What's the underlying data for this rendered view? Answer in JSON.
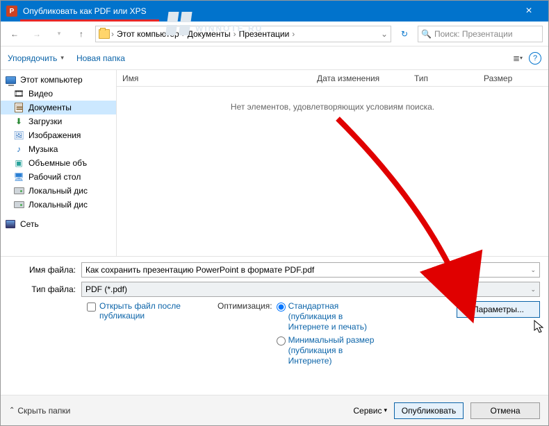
{
  "titlebar": {
    "title": "Опубликовать как PDF или XPS"
  },
  "watermark": "WINNOTE.RU",
  "nav": {
    "segments": [
      "Этот компьютер",
      "Документы",
      "Презентации"
    ],
    "search_placeholder": "Поиск: Презентации"
  },
  "toolbar": {
    "organize": "Упорядочить",
    "new_folder": "Новая папка"
  },
  "sidebar": {
    "items": [
      {
        "label": "Этот компьютер",
        "icon": "pc"
      },
      {
        "label": "Видео",
        "icon": "video"
      },
      {
        "label": "Документы",
        "icon": "doc",
        "selected": true
      },
      {
        "label": "Загрузки",
        "icon": "down"
      },
      {
        "label": "Изображения",
        "icon": "img"
      },
      {
        "label": "Музыка",
        "icon": "music"
      },
      {
        "label": "Объемные объ",
        "icon": "cube"
      },
      {
        "label": "Рабочий стол",
        "icon": "desk"
      },
      {
        "label": "Локальный дис",
        "icon": "drive"
      },
      {
        "label": "Локальный дис",
        "icon": "drive"
      }
    ],
    "network": "Сеть"
  },
  "columns": {
    "name": "Имя",
    "date": "Дата изменения",
    "type": "Тип",
    "size": "Размер"
  },
  "empty": "Нет элементов, удовлетворяющих условиям поиска.",
  "form": {
    "filename_label": "Имя файла:",
    "filename": "Как сохранить презентацию PowerPoint в формате PDF.pdf",
    "filetype_label": "Тип файла:",
    "filetype": "PDF (*.pdf)",
    "open_after": "Открыть файл после публикации",
    "optimization_label": "Оптимизация:",
    "opt_standard": "Стандартная (публикация в Интернете и печать)",
    "opt_minimum": "Минимальный размер (публикация в Интернете)",
    "options_btn": "Параметры..."
  },
  "footer": {
    "hide": "Скрыть папки",
    "tools": "Сервис",
    "publish": "Опубликовать",
    "cancel": "Отмена"
  }
}
